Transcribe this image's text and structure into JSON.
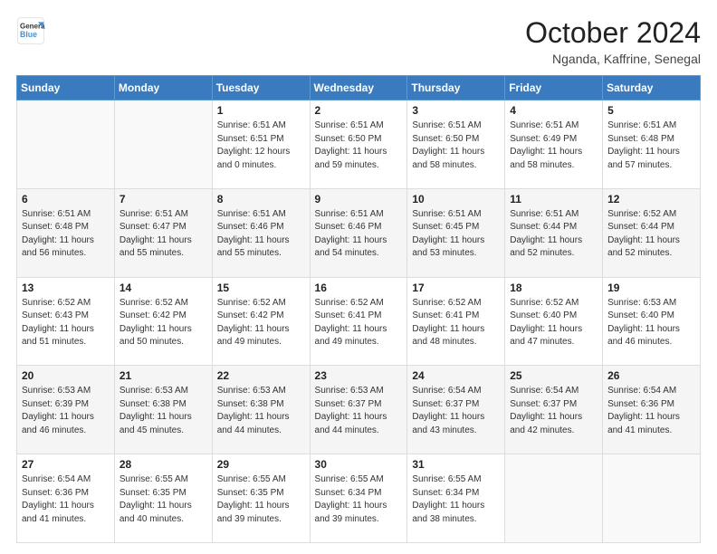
{
  "header": {
    "logo_line1": "General",
    "logo_line2": "Blue",
    "month_title": "October 2024",
    "location": "Nganda, Kaffrine, Senegal"
  },
  "weekdays": [
    "Sunday",
    "Monday",
    "Tuesday",
    "Wednesday",
    "Thursday",
    "Friday",
    "Saturday"
  ],
  "weeks": [
    [
      {
        "day": "",
        "info": ""
      },
      {
        "day": "",
        "info": ""
      },
      {
        "day": "1",
        "info": "Sunrise: 6:51 AM\nSunset: 6:51 PM\nDaylight: 12 hours and 0 minutes."
      },
      {
        "day": "2",
        "info": "Sunrise: 6:51 AM\nSunset: 6:50 PM\nDaylight: 11 hours and 59 minutes."
      },
      {
        "day": "3",
        "info": "Sunrise: 6:51 AM\nSunset: 6:50 PM\nDaylight: 11 hours and 58 minutes."
      },
      {
        "day": "4",
        "info": "Sunrise: 6:51 AM\nSunset: 6:49 PM\nDaylight: 11 hours and 58 minutes."
      },
      {
        "day": "5",
        "info": "Sunrise: 6:51 AM\nSunset: 6:48 PM\nDaylight: 11 hours and 57 minutes."
      }
    ],
    [
      {
        "day": "6",
        "info": "Sunrise: 6:51 AM\nSunset: 6:48 PM\nDaylight: 11 hours and 56 minutes."
      },
      {
        "day": "7",
        "info": "Sunrise: 6:51 AM\nSunset: 6:47 PM\nDaylight: 11 hours and 55 minutes."
      },
      {
        "day": "8",
        "info": "Sunrise: 6:51 AM\nSunset: 6:46 PM\nDaylight: 11 hours and 55 minutes."
      },
      {
        "day": "9",
        "info": "Sunrise: 6:51 AM\nSunset: 6:46 PM\nDaylight: 11 hours and 54 minutes."
      },
      {
        "day": "10",
        "info": "Sunrise: 6:51 AM\nSunset: 6:45 PM\nDaylight: 11 hours and 53 minutes."
      },
      {
        "day": "11",
        "info": "Sunrise: 6:51 AM\nSunset: 6:44 PM\nDaylight: 11 hours and 52 minutes."
      },
      {
        "day": "12",
        "info": "Sunrise: 6:52 AM\nSunset: 6:44 PM\nDaylight: 11 hours and 52 minutes."
      }
    ],
    [
      {
        "day": "13",
        "info": "Sunrise: 6:52 AM\nSunset: 6:43 PM\nDaylight: 11 hours and 51 minutes."
      },
      {
        "day": "14",
        "info": "Sunrise: 6:52 AM\nSunset: 6:42 PM\nDaylight: 11 hours and 50 minutes."
      },
      {
        "day": "15",
        "info": "Sunrise: 6:52 AM\nSunset: 6:42 PM\nDaylight: 11 hours and 49 minutes."
      },
      {
        "day": "16",
        "info": "Sunrise: 6:52 AM\nSunset: 6:41 PM\nDaylight: 11 hours and 49 minutes."
      },
      {
        "day": "17",
        "info": "Sunrise: 6:52 AM\nSunset: 6:41 PM\nDaylight: 11 hours and 48 minutes."
      },
      {
        "day": "18",
        "info": "Sunrise: 6:52 AM\nSunset: 6:40 PM\nDaylight: 11 hours and 47 minutes."
      },
      {
        "day": "19",
        "info": "Sunrise: 6:53 AM\nSunset: 6:40 PM\nDaylight: 11 hours and 46 minutes."
      }
    ],
    [
      {
        "day": "20",
        "info": "Sunrise: 6:53 AM\nSunset: 6:39 PM\nDaylight: 11 hours and 46 minutes."
      },
      {
        "day": "21",
        "info": "Sunrise: 6:53 AM\nSunset: 6:38 PM\nDaylight: 11 hours and 45 minutes."
      },
      {
        "day": "22",
        "info": "Sunrise: 6:53 AM\nSunset: 6:38 PM\nDaylight: 11 hours and 44 minutes."
      },
      {
        "day": "23",
        "info": "Sunrise: 6:53 AM\nSunset: 6:37 PM\nDaylight: 11 hours and 44 minutes."
      },
      {
        "day": "24",
        "info": "Sunrise: 6:54 AM\nSunset: 6:37 PM\nDaylight: 11 hours and 43 minutes."
      },
      {
        "day": "25",
        "info": "Sunrise: 6:54 AM\nSunset: 6:37 PM\nDaylight: 11 hours and 42 minutes."
      },
      {
        "day": "26",
        "info": "Sunrise: 6:54 AM\nSunset: 6:36 PM\nDaylight: 11 hours and 41 minutes."
      }
    ],
    [
      {
        "day": "27",
        "info": "Sunrise: 6:54 AM\nSunset: 6:36 PM\nDaylight: 11 hours and 41 minutes."
      },
      {
        "day": "28",
        "info": "Sunrise: 6:55 AM\nSunset: 6:35 PM\nDaylight: 11 hours and 40 minutes."
      },
      {
        "day": "29",
        "info": "Sunrise: 6:55 AM\nSunset: 6:35 PM\nDaylight: 11 hours and 39 minutes."
      },
      {
        "day": "30",
        "info": "Sunrise: 6:55 AM\nSunset: 6:34 PM\nDaylight: 11 hours and 39 minutes."
      },
      {
        "day": "31",
        "info": "Sunrise: 6:55 AM\nSunset: 6:34 PM\nDaylight: 11 hours and 38 minutes."
      },
      {
        "day": "",
        "info": ""
      },
      {
        "day": "",
        "info": ""
      }
    ]
  ]
}
